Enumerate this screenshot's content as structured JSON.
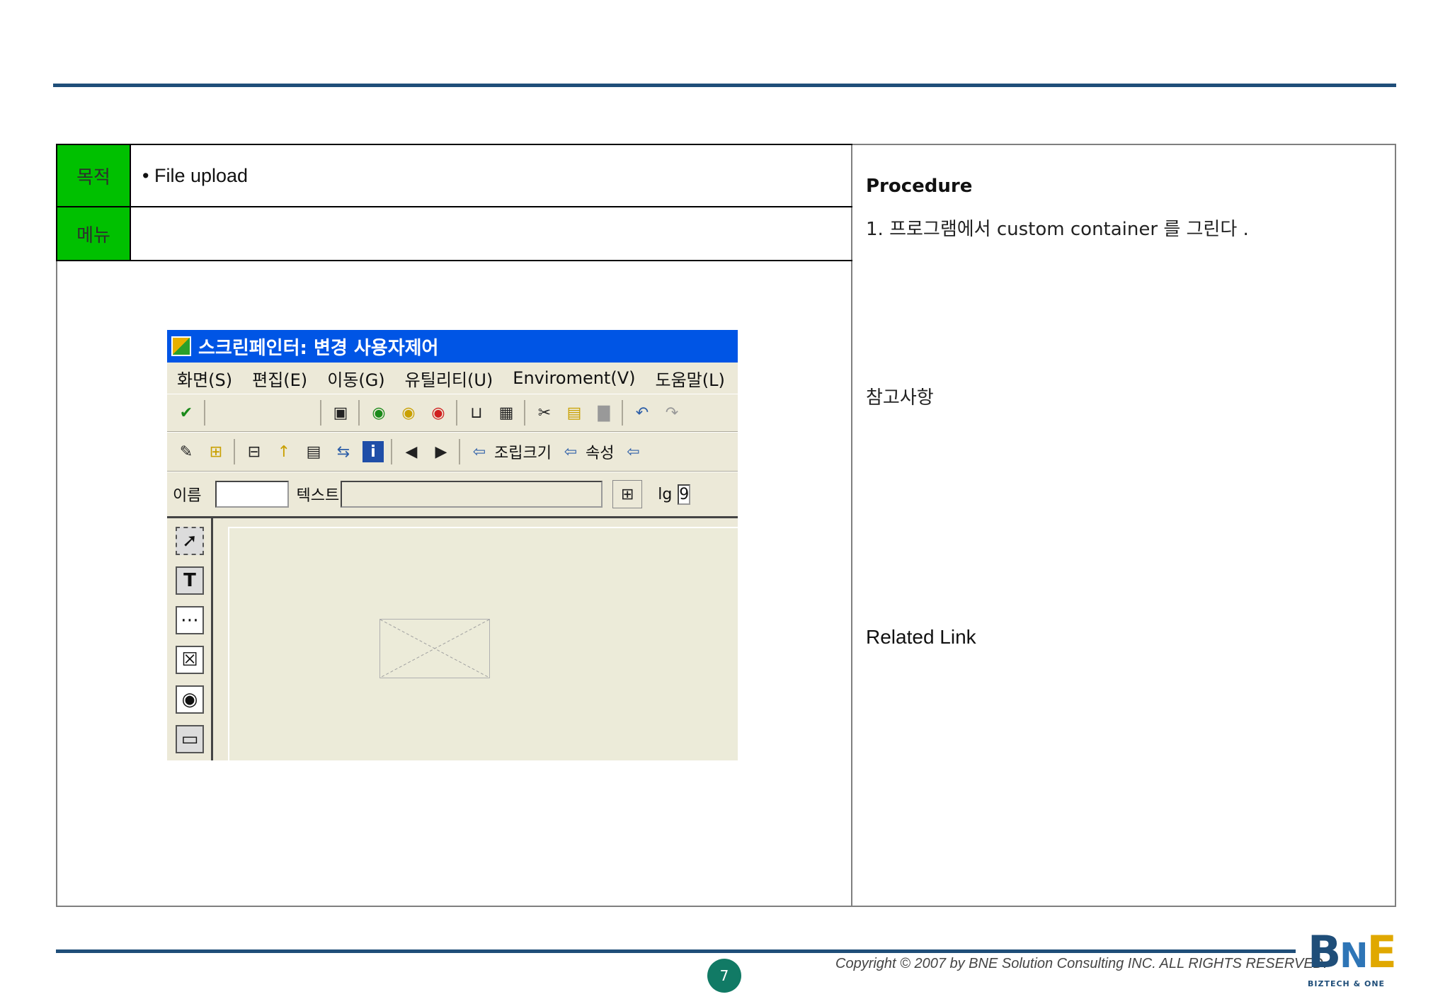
{
  "header": {
    "purpose_label": "목적",
    "purpose_value": "• File upload",
    "menu_label": "메뉴",
    "menu_value": ""
  },
  "right_panel": {
    "procedure_title": "Procedure",
    "procedure_step_1": "1.  프로그램에서  custom container 를 그린다 .",
    "notes_title": "참고사항",
    "related_link_title": "Related Link"
  },
  "screenshot": {
    "window_title": "스크린페인터: 변경 사용자제어",
    "menu_items": [
      "화면(S)",
      "편집(E)",
      "이동(G)",
      "유틸리티(U)",
      "Enviroment(V)",
      "도움말(L)"
    ],
    "toolbar_text_1": "조립크기",
    "toolbar_text_2": "속성",
    "field_label_1": "이름",
    "field_label_2": "텍스트",
    "field_label_3": "lg",
    "field_value_3": "9"
  },
  "footer": {
    "page_number": "7",
    "copyright": "Copyright © 2007 by BNE Solution Consulting INC.   ALL RIGHTS RESERVED.",
    "logo_text": "BNE",
    "logo_subtext": "BIZTECH & ONE"
  }
}
